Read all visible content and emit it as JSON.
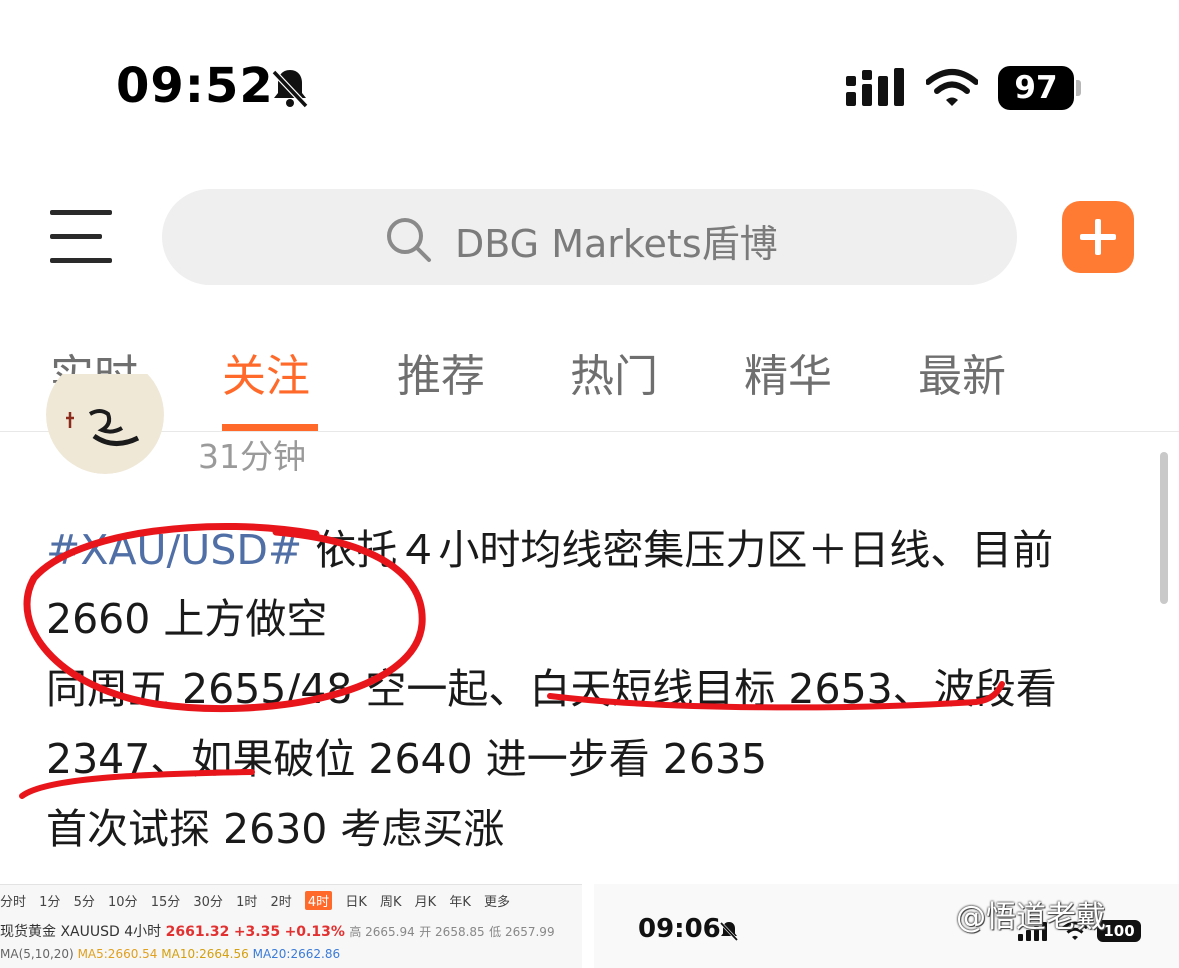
{
  "status_bar": {
    "time": "09:52",
    "battery": "97",
    "icons": [
      "bell-off-icon",
      "signal-icon",
      "wifi-icon",
      "battery-icon"
    ]
  },
  "top_bar": {
    "search_placeholder": "DBG Markets盾博",
    "icons": [
      "menu-icon",
      "search-icon",
      "plus-icon"
    ]
  },
  "tabs": [
    {
      "label": "实时",
      "active": false
    },
    {
      "label": "关注",
      "active": true
    },
    {
      "label": "推荐",
      "active": false
    },
    {
      "label": "热门",
      "active": false
    },
    {
      "label": "精华",
      "active": false
    },
    {
      "label": "最新",
      "active": false
    }
  ],
  "colors": {
    "accent": "#ff6a2b",
    "hashtag": "#4f6fa6",
    "annotation_red": "#e8161b"
  },
  "post": {
    "time_ago": "31分钟",
    "hashtag": "#XAU/USD#",
    "line1_rest": " 依托４小时均线密集压力区＋日线、目前",
    "line2": "2660 上方做空",
    "line3": "同周五 2655/48 空一起、白天短线目标 2653、波段看",
    "line4": "2347、如果破位 2640 进一步看 2635",
    "line5": "首次试探 2630 考虑买涨"
  },
  "thumb_left": {
    "periods": [
      "分时",
      "1分",
      "5分",
      "10分",
      "15分",
      "30分",
      "1时",
      "2时",
      "4时",
      "日K",
      "周K",
      "月K",
      "年K",
      "更多"
    ],
    "active_period": "4时",
    "symbol": "现货黄金 XAUUSD",
    "interval": "4小时",
    "price": "2661.32",
    "change": "+3.35",
    "change_pct": "+0.13%",
    "high": "高 2665.94",
    "open": "开 2658.85",
    "low": "低 2657.99",
    "ma_label": "MA(5,10,20)",
    "ma5": "MA5:2660.54",
    "ma10": "MA10:2664.56",
    "ma20": "MA20:2662.86"
  },
  "thumb_right": {
    "time": "09:06",
    "battery": "100"
  },
  "watermark": "@悟道老戴"
}
